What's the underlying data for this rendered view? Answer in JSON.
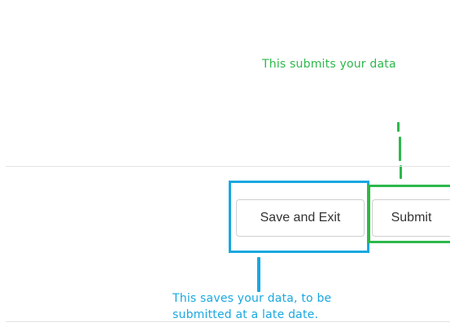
{
  "annotations": {
    "submit_note": "This submits your data",
    "save_note": "This saves your data, to be submitted at a late date."
  },
  "buttons": {
    "save_and_exit": "Save and Exit",
    "submit": "Submit"
  },
  "colors": {
    "annotation_green": "#2db84b",
    "annotation_blue": "#19a8e0",
    "button_text": "#333333",
    "button_border": "#cfcfcf",
    "divider": "#e3e3e3"
  }
}
